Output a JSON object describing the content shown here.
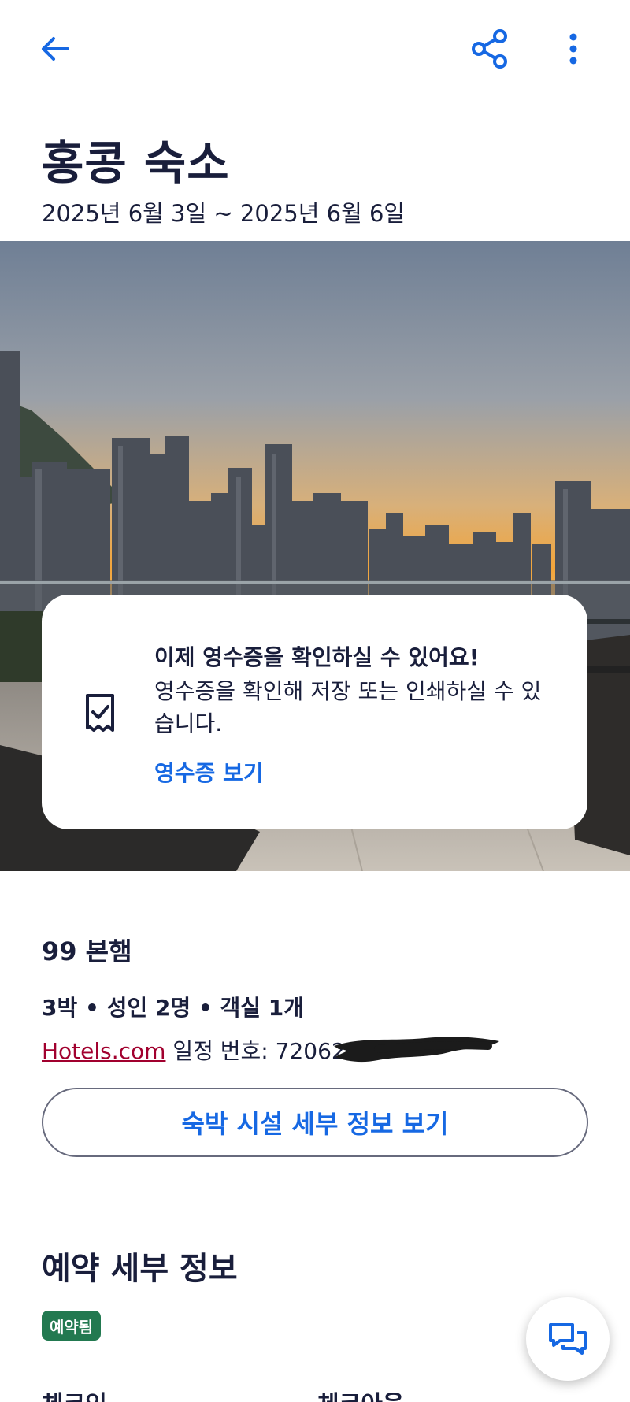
{
  "header": {
    "back_icon": "arrow-left-icon",
    "share_icon": "share-icon",
    "more_icon": "more-vertical-icon",
    "accent_color": "#1668e3"
  },
  "trip": {
    "title": "홍콩 숙소",
    "dates": "2025년 6월 3일 ~ 2025년 6월 6일"
  },
  "receipt_card": {
    "icon": "receipt-icon",
    "title": "이제 영수증을 확인하실 수 있어요!",
    "description": "영수증을 확인해 저장 또는 인쇄하실 수 있습니다.",
    "link_label": "영수증 보기"
  },
  "hotel": {
    "name": "99 본햄",
    "summary": "3박 • 성인 2명 • 객실 1개",
    "brand_link": "Hotels.com",
    "itinerary_label": " 일정 번호: 72062",
    "details_button": "숙박 시설 세부 정보 보기"
  },
  "booking": {
    "section_title": "예약 세부 정보",
    "status": "예약됨",
    "status_color": "#227950",
    "checkin_label": "체크인",
    "checkout_label": "체크아웃"
  },
  "chat_fab": {
    "icon": "chat-bubbles-icon"
  }
}
